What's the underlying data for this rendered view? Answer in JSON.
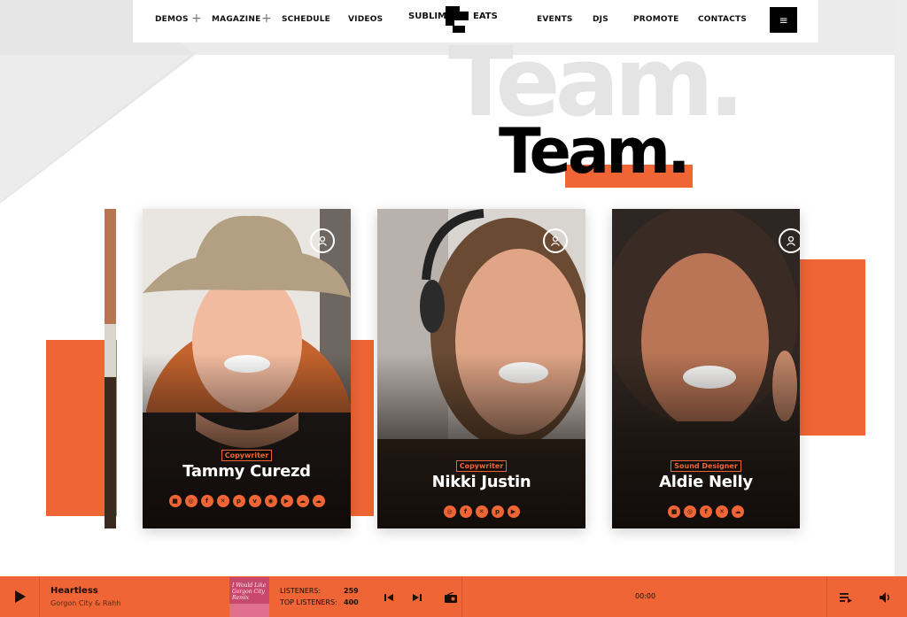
{
  "header": {
    "nav_left": [
      "DEMOS",
      "MAGAZINE",
      "SCHEDULE",
      "VIDEOS"
    ],
    "nav_right": [
      "EVENTS",
      "DJS",
      "PROMOTE",
      "CONTACTS"
    ],
    "plus": "+",
    "logo_left": "SUBLIME",
    "logo_right": "EATS",
    "menu_icon": "≡"
  },
  "hero": {
    "ghost_title": "Team.",
    "title": "Team."
  },
  "team": [
    {
      "role": "Copywriter",
      "name": "Tammy Curezd",
      "socials": [
        "■",
        "◎",
        "f",
        "✕",
        "p",
        "v",
        "◉",
        "▶",
        "☁",
        "☁"
      ],
      "icon": "user-icon"
    },
    {
      "role": "Copywriter",
      "name": "Nikki Justin",
      "socials": [
        "◎",
        "f",
        "✕",
        "p",
        "▶"
      ],
      "icon": "user-icon"
    },
    {
      "role": "Sound Designer",
      "name": "Aldie Nelly",
      "socials": [
        "■",
        "◎",
        "f",
        "✕",
        "☁"
      ],
      "icon": "user-icon"
    }
  ],
  "player": {
    "track_title": "Heartless",
    "track_artist": "Gorgon City & Rahh",
    "listeners_label": "LISTENERS:",
    "listeners_value": "259",
    "top_listeners_label": "TOP LISTENERS:",
    "top_listeners_value": "400",
    "time": "00:00",
    "cover_text": "I Would Like Gorgon City Remix"
  },
  "colors": {
    "accent": "#f06535",
    "dark": "#000000",
    "ghost": "#e4e4e4"
  }
}
